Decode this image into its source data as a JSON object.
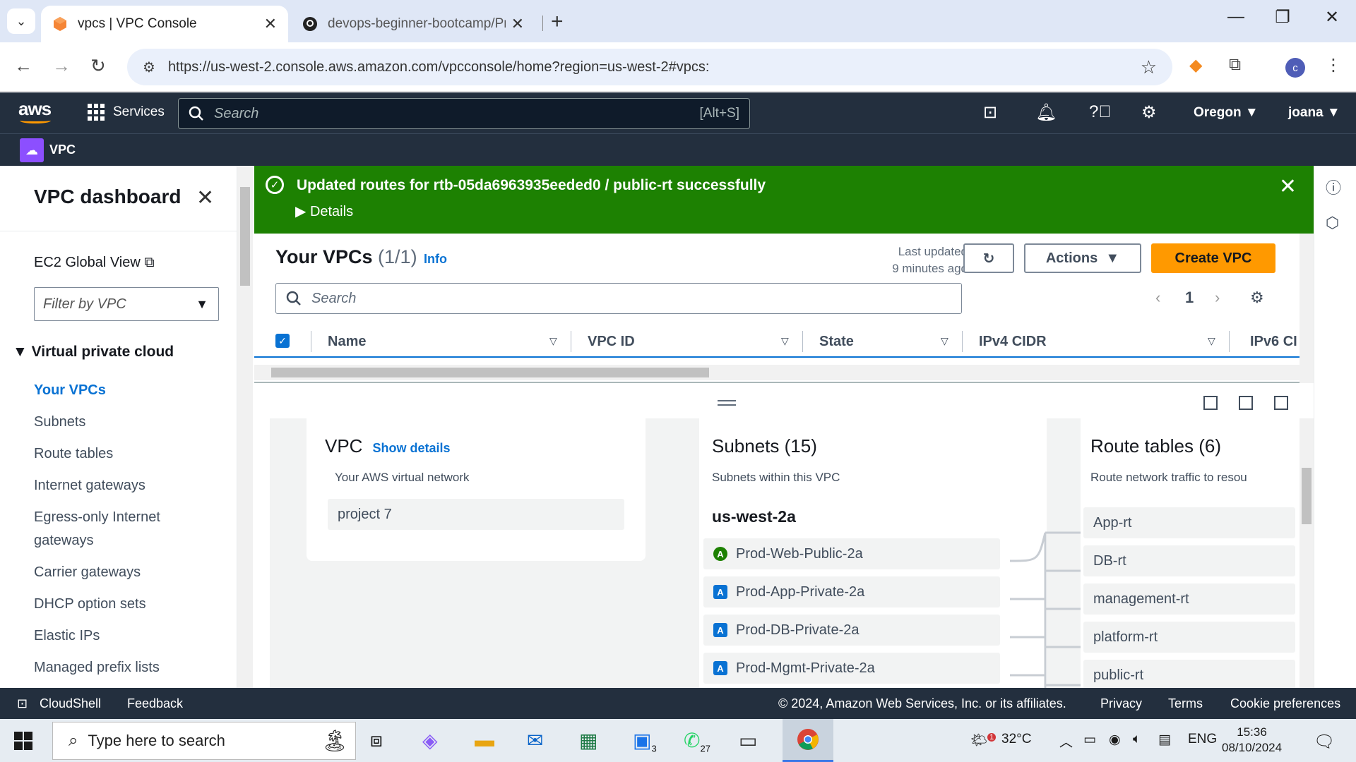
{
  "browser": {
    "tabs": [
      {
        "title": "vpcs | VPC Console"
      },
      {
        "title": "devops-beginner-bootcamp/Pr"
      }
    ],
    "url": "https://us-west-2.console.aws.amazon.com/vpcconsole/home?region=us-west-2#vpcs:",
    "profile_initial": "c"
  },
  "aws_header": {
    "logo": "aws",
    "services_label": "Services",
    "search_placeholder": "Search",
    "search_shortcut": "[Alt+S]",
    "region": "Oregon",
    "user": "joana",
    "service_name": "VPC"
  },
  "sidebar": {
    "title": "VPC dashboard",
    "ec2_global_view": "EC2 Global View",
    "filter_placeholder": "Filter by VPC",
    "section": "Virtual private cloud",
    "items": [
      {
        "label": "Your VPCs",
        "active": true
      },
      {
        "label": "Subnets"
      },
      {
        "label": "Route tables"
      },
      {
        "label": "Internet gateways"
      },
      {
        "label": "Egress-only Internet gateways"
      },
      {
        "label": "Carrier gateways"
      },
      {
        "label": "DHCP option sets"
      },
      {
        "label": "Elastic IPs"
      },
      {
        "label": "Managed prefix lists"
      }
    ]
  },
  "flash": {
    "message": "Updated routes for rtb-05da6963935eeded0 / public-rt successfully",
    "details": "Details"
  },
  "vpc_table": {
    "title": "Your VPCs",
    "count": "(1/1)",
    "info": "Info",
    "last_updated_line1": "Last updated",
    "last_updated_line2": "9 minutes ago",
    "actions_label": "Actions",
    "create_label": "Create VPC",
    "search_placeholder": "Search",
    "page": "1",
    "columns": [
      "Name",
      "VPC ID",
      "State",
      "IPv4 CIDR",
      "IPv6 CI"
    ]
  },
  "resource_map": {
    "vpc_card": {
      "title": "VPC",
      "show_details": "Show details",
      "subtitle": "Your AWS virtual network",
      "vpc_name": "project 7"
    },
    "subnets": {
      "title": "Subnets (15)",
      "subtitle": "Subnets within this VPC",
      "az": "us-west-2a",
      "items": [
        {
          "badge": "A",
          "name": "Prod-Web-Public-2a"
        },
        {
          "badge": "A",
          "name": "Prod-App-Private-2a"
        },
        {
          "badge": "A",
          "name": "Prod-DB-Private-2a"
        },
        {
          "badge": "A",
          "name": "Prod-Mgmt-Private-2a"
        }
      ]
    },
    "route_tables": {
      "title": "Route tables (6)",
      "subtitle": "Route network traffic to resou",
      "items": [
        "App-rt",
        "DB-rt",
        "management-rt",
        "platform-rt",
        "public-rt"
      ]
    }
  },
  "footer": {
    "cloudshell": "CloudShell",
    "feedback": "Feedback",
    "copyright": "© 2024, Amazon Web Services, Inc. or its affiliates.",
    "privacy": "Privacy",
    "terms": "Terms",
    "cookies": "Cookie preferences"
  },
  "taskbar": {
    "search_placeholder": "Type here to search",
    "badge_mail": "3",
    "badge_whatsapp": "27",
    "weather_badge": "1",
    "temperature": "32°C",
    "language": "ENG",
    "time": "15:36",
    "date": "08/10/2024"
  }
}
